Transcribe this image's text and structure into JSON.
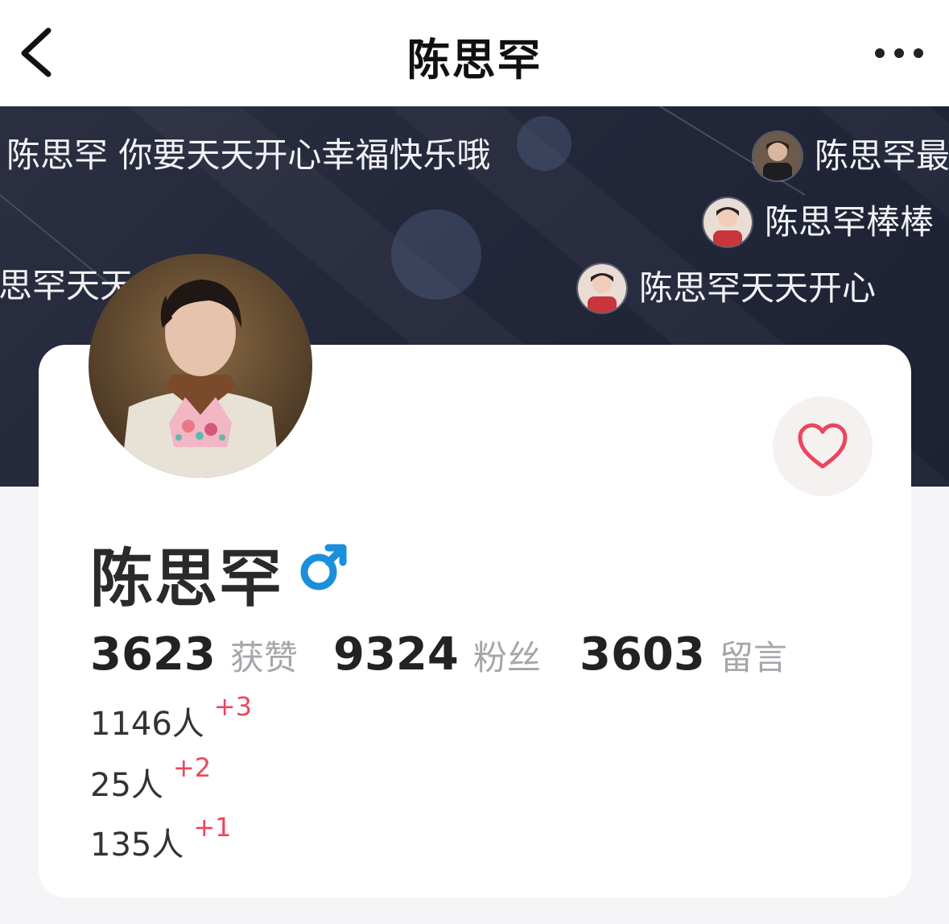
{
  "header": {
    "title": "陈思罕"
  },
  "danmaku": [
    {
      "text": "陈思罕 你要天天开心幸福快乐哦",
      "has_avatar": false
    },
    {
      "text": "陈思罕最",
      "has_avatar": true
    },
    {
      "text": "陈思罕棒棒",
      "has_avatar": true
    },
    {
      "text": "思罕天天",
      "has_avatar": false
    },
    {
      "text": "陈思罕天天开心",
      "has_avatar": true
    }
  ],
  "profile": {
    "name": "陈思罕",
    "gender_icon": "male-symbol-icon",
    "accent_color": "#1a8fdc",
    "like_icon": "heart-outline-icon",
    "like_color": "#e8475f"
  },
  "stats": [
    {
      "value": "3623",
      "label": "获赞"
    },
    {
      "value": "9324",
      "label": "粉丝"
    },
    {
      "value": "3603",
      "label": "留言"
    }
  ],
  "sub_stats": [
    {
      "count": "1146人",
      "delta": "+3"
    },
    {
      "count": "25人",
      "delta": "+2"
    },
    {
      "count": "135人",
      "delta": "+1"
    }
  ]
}
